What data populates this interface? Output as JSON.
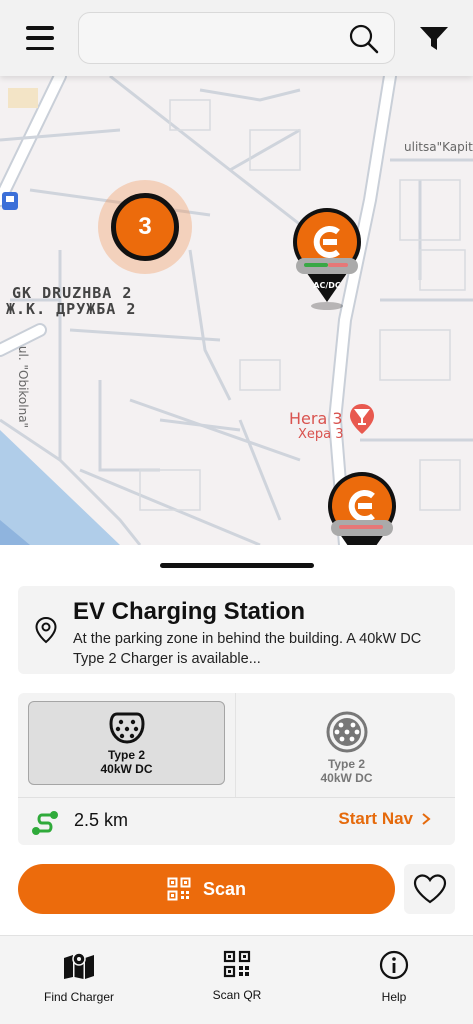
{
  "search": {
    "placeholder": "",
    "value": ""
  },
  "map": {
    "labels": {
      "district_en": "GK DRUZHBA 2",
      "district_bg": "Ж.К. ДРУЖБА 2",
      "street_obikolna": "ul. \"Obikolna\"",
      "street_kapit": "ulitsa\"Kapit",
      "poi_en": "Hera 3",
      "poi_bg": "Хера 3"
    },
    "cluster_count": "3",
    "pin_type_label": "AC/DC"
  },
  "station": {
    "title": "EV Charging Station",
    "description": "At the parking zone in behind the building. A 40kW DC Type 2 Charger is available..."
  },
  "connectors": [
    {
      "name": "Type 2",
      "power": "40kW DC",
      "selected": true
    },
    {
      "name": "Type 2",
      "power": "40kW DC",
      "selected": false
    }
  ],
  "distance": "2.5 km",
  "start_nav_label": "Start Nav",
  "scan_label": "Scan",
  "bottom_nav": [
    {
      "label": "Find Charger",
      "icon": "map-icon"
    },
    {
      "label": "Scan QR",
      "icon": "qr-code-icon"
    },
    {
      "label": "Help",
      "icon": "info-icon"
    }
  ],
  "colors": {
    "accent": "#ec6b0c",
    "route_green": "#2faa3a",
    "poi_red": "#d9534f"
  }
}
